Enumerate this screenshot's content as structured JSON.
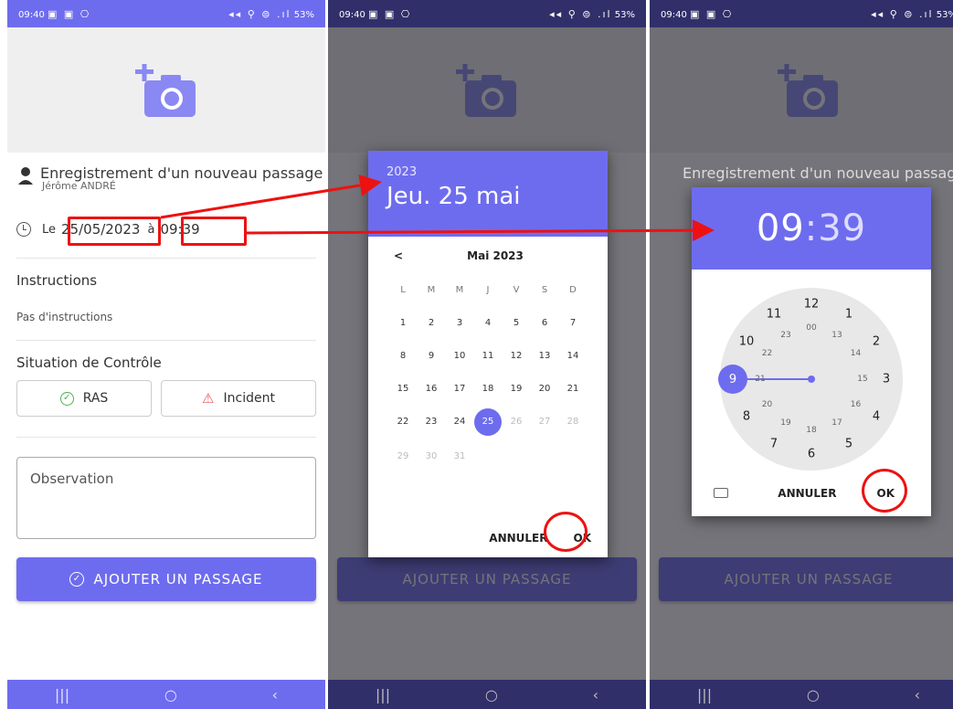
{
  "status_bar": {
    "time": "09:40",
    "left_icons": "▣ ▣ ⎔",
    "right_icons": "◂◂ ⚲ ⊜ .ıl",
    "battery": "53%"
  },
  "form": {
    "title": "Enregistrement d'un nouveau passage",
    "user": "Jérôme ANDRÉ",
    "date_prefix": "Le",
    "date_value": "25/05/2023",
    "time_prefix": "à",
    "time_value": "09:39",
    "instructions_heading": "Instructions",
    "instructions_text": "Pas d'instructions",
    "situation_heading": "Situation de Contrôle",
    "ras_label": "RAS",
    "incident_label": "Incident",
    "observation_placeholder": "Observation",
    "add_button": "AJOUTER UN PASSAGE"
  },
  "date_picker": {
    "year": "2023",
    "selected_date": "Jeu. 25 mai",
    "month_label": "Mai 2023",
    "weekdays": [
      "L",
      "M",
      "M",
      "J",
      "V",
      "S",
      "D"
    ],
    "weeks": [
      [
        "",
        "1",
        "2",
        "3",
        "4",
        "5",
        "6",
        "7"
      ],
      [
        "8",
        "9",
        "10",
        "11",
        "12",
        "13",
        "14"
      ],
      [
        "15",
        "16",
        "17",
        "18",
        "19",
        "20",
        "21"
      ],
      [
        "22",
        "23",
        "24",
        "25",
        "26",
        "27",
        "28"
      ],
      [
        "29",
        "30",
        "31",
        "",
        "",
        "",
        ""
      ]
    ],
    "selected_day": "25",
    "cancel": "ANNULER",
    "ok": "OK"
  },
  "time_picker": {
    "hours": "09",
    "separator": ":",
    "minutes": "39",
    "outer": [
      "12",
      "1",
      "2",
      "3",
      "4",
      "5",
      "6",
      "7",
      "8",
      "9",
      "10",
      "11"
    ],
    "inner": [
      "00",
      "13",
      "14",
      "15",
      "16",
      "17",
      "18",
      "19",
      "20",
      "21",
      "22",
      "23"
    ],
    "selected_hour": "9",
    "cancel": "ANNULER",
    "ok": "OK"
  },
  "nav": {
    "recent": "|||",
    "home": "○",
    "back": "‹"
  },
  "colors": {
    "accent": "#6e6cee",
    "annotation": "#ee1111"
  }
}
